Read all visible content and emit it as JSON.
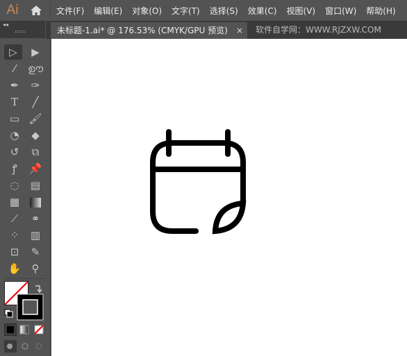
{
  "app": {
    "logo": "Ai"
  },
  "menu": [
    "文件(F)",
    "编辑(E)",
    "对象(O)",
    "文字(T)",
    "选择(S)",
    "效果(C)",
    "视图(V)",
    "窗口(W)",
    "帮助(H)"
  ],
  "tab": {
    "title": "未标题-1.ai* @ 176.53% (CMYK/GPU 预览)",
    "close": "×"
  },
  "site_text": "软件自学网：WWW.RJZXW.COM",
  "tools": [
    "selection",
    "direct-selection",
    "magic-wand",
    "lasso",
    "pen",
    "curvature",
    "type",
    "line",
    "rectangle",
    "paintbrush",
    "shaper",
    "eraser",
    "rotate",
    "scale",
    "warp",
    "puppet-warp",
    "free-transform",
    "perspective-grid",
    "mesh",
    "gradient",
    "eyedropper",
    "blend",
    "symbol-sprayer",
    "column-graph",
    "artboard",
    "slice",
    "hand",
    "zoom"
  ],
  "colors": {
    "accent": "#d08a52",
    "fill": "#ffffff",
    "stroke": "#000000"
  }
}
